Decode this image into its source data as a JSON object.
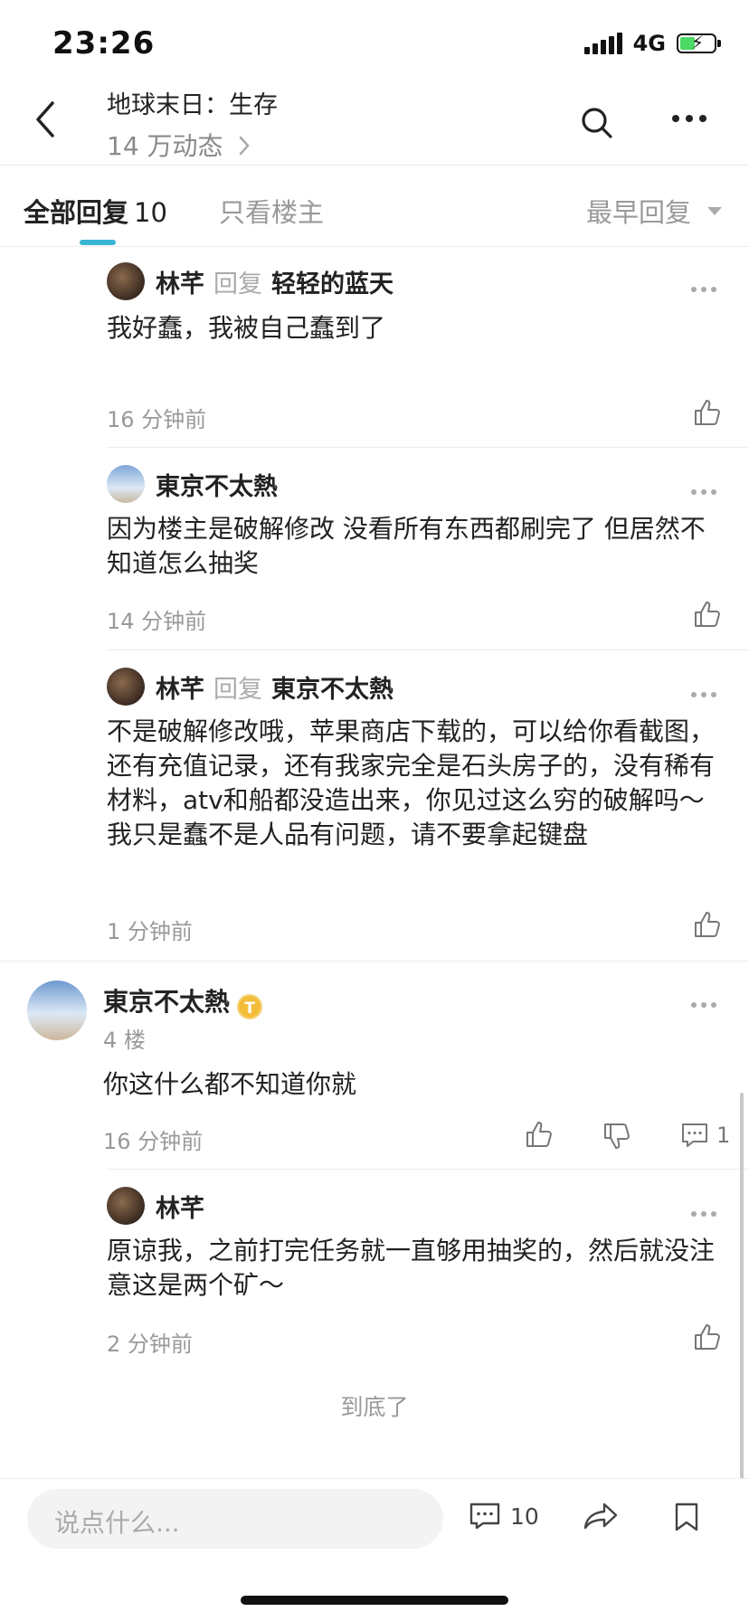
{
  "status": {
    "time": "23:26",
    "network": "4G"
  },
  "header": {
    "title": "地球末日：生存",
    "subtitle": "14 万动态"
  },
  "tabs": {
    "all_label": "全部回复",
    "all_count": "10",
    "op_label": "只看楼主",
    "sort_label": "最早回复"
  },
  "replies": [
    {
      "user": "林芊",
      "reply_word": "回复",
      "reply_to": "轻轻的蓝天",
      "content": "我好蠢，我被自己蠢到了",
      "time": "16 分钟前"
    },
    {
      "user": "東京不太熱",
      "content": "因为楼主是破解修改  没看所有东西都刷完了  但居然不知道怎么抽奖",
      "time": "14 分钟前"
    },
    {
      "user": "林芊",
      "reply_word": "回复",
      "reply_to": "東京不太熱",
      "content": "不是破解修改哦，苹果商店下载的，可以给你看截图，还有充值记录，还有我家完全是石头房子的，没有稀有材料，atv和船都没造出来，你见过这么穷的破解吗～我只是蠢不是人品有问题，请不要拿起键盘",
      "time": "1 分钟前"
    }
  ],
  "floor4": {
    "user": "東京不太熱",
    "badge": "T",
    "floor": "4 楼",
    "content": "你这什么都不知道你就",
    "time": "16 分钟前",
    "comment_count": "1",
    "sub_reply": {
      "user": "林芊",
      "content": "原谅我，之前打完任务就一直够用抽奖的，然后就没注意这是两个矿～",
      "time": "2 分钟前"
    }
  },
  "end_text": "到底了",
  "bottom": {
    "input_placeholder": "说点什么...",
    "comment_count": "10"
  },
  "colors": {
    "accent": "#3ab4d4",
    "badge": "#f3bd3a",
    "battery": "#4cd964"
  }
}
